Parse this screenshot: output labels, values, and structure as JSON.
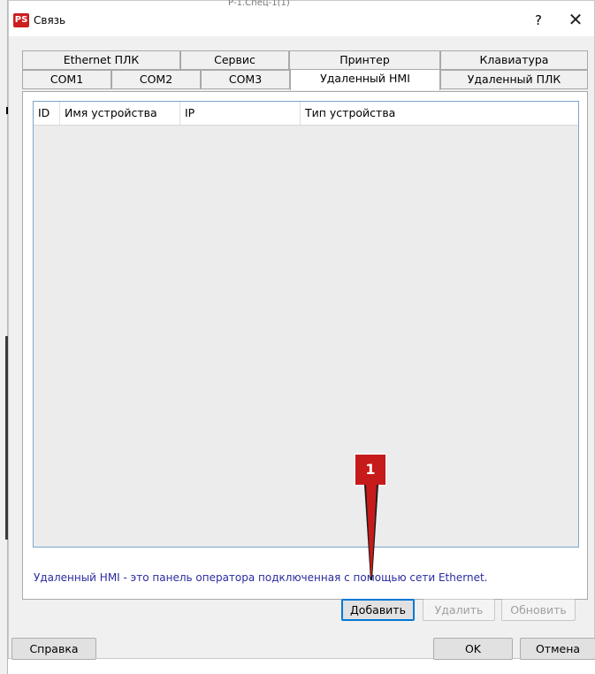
{
  "window": {
    "title": "Связь",
    "app_icon": "PS",
    "background_file": "Р-1.Спец-1(1)"
  },
  "title_buttons": {
    "help": "?",
    "close": "✕"
  },
  "tabs_row1": [
    "Ethernet ПЛК",
    "Сервис",
    "Принтер",
    "Клавиатура"
  ],
  "tabs_row2": [
    "COM1",
    "COM2",
    "COM3",
    "Удаленный HMI",
    "Удаленный ПЛК"
  ],
  "active_tab": "Удаленный HMI",
  "table": {
    "columns": [
      "ID",
      "Имя устройства",
      "IP",
      "Тип устройства"
    ],
    "rows": []
  },
  "description": "Удаленный HMI - это панель оператора подключенная с помощью сети Ethernet.",
  "buttons": {
    "add": "Добавить",
    "delete": "Удалить",
    "refresh": "Обновить",
    "help": "Справка",
    "ok": "OK",
    "cancel": "Отмена"
  },
  "annotation": {
    "number": "1",
    "color": "#c71a1a"
  },
  "colors": {
    "accent": "#0078d7",
    "description_text": "#2b2ba0",
    "table_border": "#7aa6cc"
  }
}
